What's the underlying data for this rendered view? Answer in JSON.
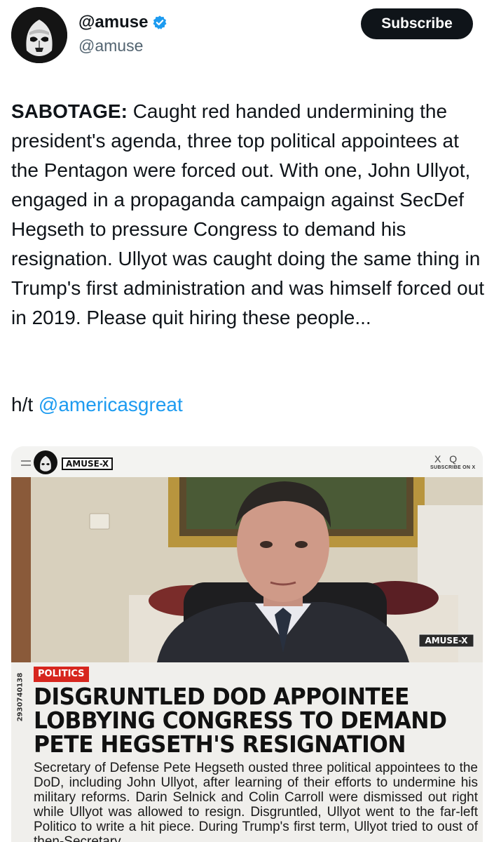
{
  "author": {
    "display_name": "@amuse",
    "handle": "@amuse",
    "verified": true,
    "avatar_icon": "stormtrooper-avatar-icon"
  },
  "subscribe_label": "Subscribe",
  "post": {
    "lead": "SABOTAGE:",
    "body": " Caught red handed undermining the president's agenda, three top political appointees at the Pentagon were forced out. With one, John Ullyot, engaged in a propaganda campaign against SecDef Hegseth to pressure Congress to demand his resignation. Ullyot was caught doing the same thing in Trump's first administration and was himself forced out in 2019. Please quit hiring these people...",
    "hat_tip_prefix": "h/t ",
    "hat_tip_mention": "@americasgreat"
  },
  "media": {
    "brand": "AMUSE-X",
    "topbar_icons": "X Q",
    "subscribe_on_x": "SUBSCRIBE ON X",
    "photo_watermark": "AMUSE-X",
    "serial": "2930740138",
    "category": "POLITICS",
    "headline_lines": [
      "DISGRUNTLED DOD APPOINTEE",
      "LOBBYING CONGRESS TO DEMAND",
      "PETE HEGSETH'S RESIGNATION"
    ],
    "summary": "Secretary of Defense Pete Hegseth ousted three political appointees to the DoD, including John Ullyot, after learning of their efforts to undermine his military reforms. Darin Selnick and Colin Carroll were dismissed out right while Ullyot was allowed to resign. Disgruntled, Ullyot went to the far-left Politico to write a hit piece. During Trump's first term, Ullyot tried to oust of then-Secretary"
  },
  "colors": {
    "text": "#0f1419",
    "secondary": "#536471",
    "link": "#1d9bf0",
    "verified": "#1d9bf0",
    "button_bg": "#0f1419",
    "category_red": "#d7261e"
  }
}
